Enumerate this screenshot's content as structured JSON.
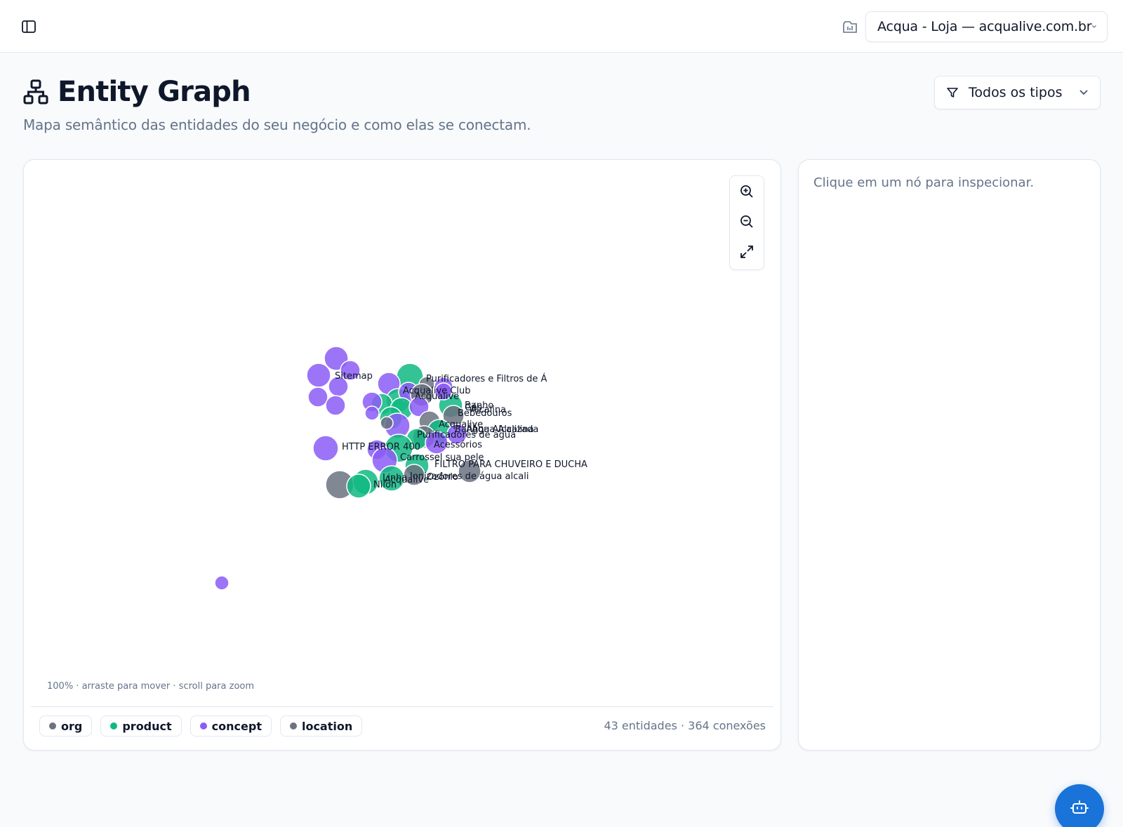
{
  "topbar": {
    "site_select_value": "Acqua - Loja — acqualive.com.br"
  },
  "page": {
    "title": "Entity Graph",
    "subtitle": "Mapa semântico das entidades do seu negócio e como elas se conectam.",
    "type_filter_value": "Todos os tipos"
  },
  "graph": {
    "hint": "100% · arraste para mover · scroll para zoom",
    "zoom_level_percent": 100,
    "stats": "43 entidades · 364 conexões",
    "legend": [
      {
        "label": "org",
        "color": "#6b7280"
      },
      {
        "label": "product",
        "color": "#10b981"
      },
      {
        "label": "concept",
        "color": "#8b5cf6"
      },
      {
        "label": "location",
        "color": "#6b7280"
      }
    ],
    "type_colors": {
      "org": "#6b7280",
      "product": "#10b981",
      "concept": "#8b5cf6",
      "location": "#6b7280"
    },
    "node_labels": [
      "Sitemap",
      "Purificadores e Filtros de Á",
      "Acqualive Club",
      "Acqualive",
      "Banho",
      "Gás",
      "Alcalina",
      "Bebedouros",
      "Acqualive",
      "Banho",
      "Água Alcalina",
      "Água Alcalizada",
      "Purificadores de água",
      "Acessórios",
      "HTTP ERROR 400",
      "Carrossel sua pele",
      "FILTRO PARA CHUVEIRO E DUCHA",
      "Linha",
      "Ionizadores de água alcali",
      "Acqualive",
      "Nilon",
      "Ozônio"
    ]
  },
  "inspector": {
    "hint": "Clique em um nó para inspecionar."
  }
}
